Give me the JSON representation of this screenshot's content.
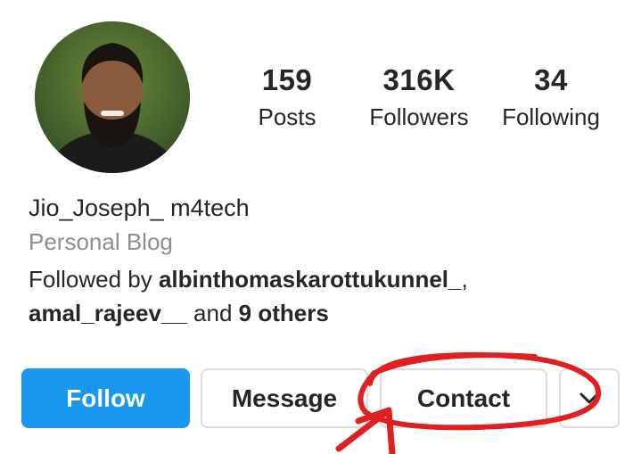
{
  "profile": {
    "username": "Jio_Joseph_ m4tech",
    "category": "Personal Blog",
    "followed_by_prefix": "Followed by ",
    "followed_by_user1": "albinthomaskarottukunnel_",
    "followed_by_sep": ",",
    "followed_by_user2": "amal_rajeev__",
    "followed_by_and": " and ",
    "followed_by_others": "9 others"
  },
  "stats": {
    "posts": {
      "value": "159",
      "label": "Posts"
    },
    "followers": {
      "value": "316K",
      "label": "Followers"
    },
    "following": {
      "value": "34",
      "label": "Following"
    }
  },
  "actions": {
    "follow": "Follow",
    "message": "Message",
    "contact": "Contact",
    "more_icon": "chevron-down-icon"
  },
  "colors": {
    "follow_blue": "#1a97ef",
    "annotation_red": "#e02020"
  }
}
